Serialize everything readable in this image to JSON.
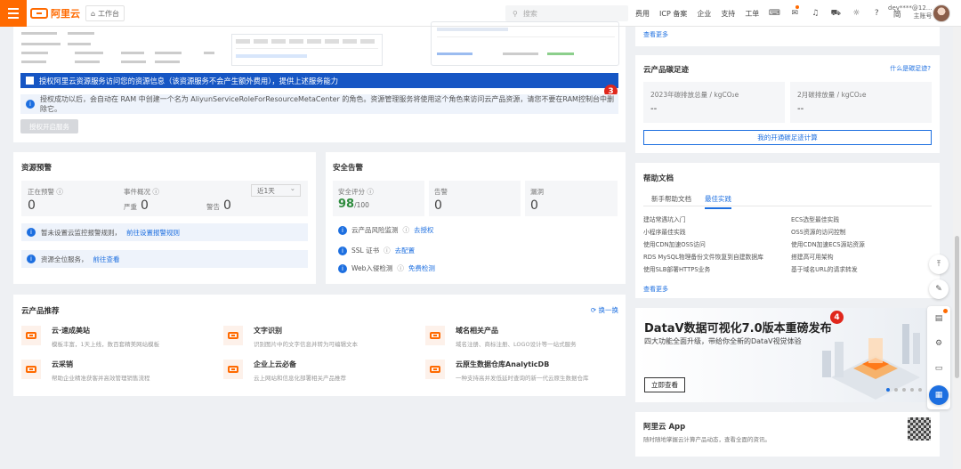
{
  "topbar": {
    "logo_text": "阿里云",
    "workbench": "工作台",
    "search_placeholder": "搜索",
    "nav": [
      "费用",
      "ICP 备案",
      "企业",
      "支持",
      "工单"
    ],
    "account_name": "dev****@12...",
    "account_role": "主账号"
  },
  "top_card": {
    "auth_checkbox_label": "授权阿里云资源服务访问您的资源信息（该资源服务不会产生额外费用），提供上述服务能力",
    "auth_info": "授权成功以后，会自动在 RAM 中创建一个名为 AliyunServiceRoleForResourceMetaCenter 的角色。资源管理服务将使用这个角色来访问云产品资源，请您不要在RAM控制台中删除它。",
    "enable_button": "授权开启服务",
    "step_badge": "3"
  },
  "resource_alerts": {
    "title": "资源预警",
    "pending_label": "正在预警",
    "pending_value": "0",
    "event_label": "事件概况",
    "period": "近1天",
    "severe_label": "严重",
    "severe_value": "0",
    "warning_label": "警告",
    "warning_value": "0",
    "info1_text": "暂未设置云监控报警规则，",
    "info1_link": "前往设置报警规则",
    "info2_text": "资源全位服务，",
    "info2_link": "前往查看"
  },
  "security_alerts": {
    "title": "安全告警",
    "score_label": "安全评分",
    "score_value": "98",
    "score_total": "/100",
    "alert_label": "告警",
    "alert_value": "0",
    "vuln_label": "漏洞",
    "vuln_value": "0",
    "rows": [
      {
        "text": "云产品风险监测",
        "link": "去授权"
      },
      {
        "text": "SSL 证书",
        "link": "去配置"
      },
      {
        "text": "Web入侵检测",
        "link": "免费检测"
      }
    ]
  },
  "recommend": {
    "title": "云产品推荐",
    "refresh": "换一换",
    "items": [
      {
        "name": "云·速成美站",
        "desc": "模板丰富，1天上线，数百套精美网站模板"
      },
      {
        "name": "文字识别",
        "desc": "识别图片中的文字信息并转为可编辑文本"
      },
      {
        "name": "域名相关产品",
        "desc": "域名注册、商标注册、LOGO设计等一站式服务"
      },
      {
        "name": "云采销",
        "desc": "帮助企业精准获客并高效管理销售流程"
      },
      {
        "name": "企业上云必备",
        "desc": "云上网站和信息化部署相关产品推荐"
      },
      {
        "name": "云原生数据仓库AnalyticDB",
        "desc": "一种支持高并发低延时查询的新一代云原生数据仓库"
      }
    ]
  },
  "right": {
    "more1": "查看更多",
    "trend_title": "云产品碳足迹",
    "trend_link": "什么是碳足迹?",
    "quota1_label": "2023年碳排放总量 / kgCO₂e",
    "quota1_value": "--",
    "quota2_label": "2月碳排放量 / kgCO₂e",
    "quota2_value": "--",
    "calc_button": "我的开通碳足迹计算",
    "help_title": "帮助文档",
    "tab_new": "新手帮助文档",
    "tab_best": "最佳实践",
    "help_links_left": [
      "建站常遇坑入门",
      "小程序最佳实践",
      "使用CDN加速OSS访问",
      "RDS MySQL物理备份文件恢复到自建数据库",
      "使用SLB部署HTTPS业务"
    ],
    "help_links_right": [
      "ECS选型最佳实践",
      "OSS资源的访问控制",
      "使用CDN加速ECS源站资源",
      "搭建高可用架构",
      "基于域名URL的请求转发"
    ],
    "more2": "查看更多",
    "banner_title": "DataV数据可视化7.0版本重磅发布",
    "banner_sub": "四大功能全面升级，带给你全新的DataV视觉体验",
    "banner_button": "立即查看",
    "banner_badge": "4",
    "app_title": "阿里云 App",
    "app_desc": "随时随地掌握云计算产品动态，查看全面的资讯。"
  }
}
